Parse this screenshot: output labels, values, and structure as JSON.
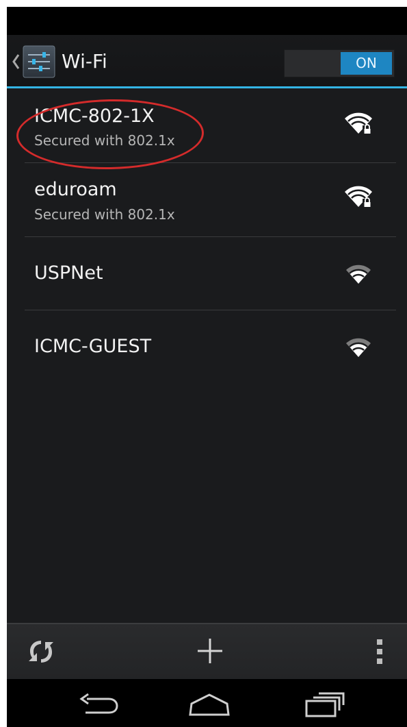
{
  "action_bar": {
    "title": "Wi-Fi",
    "toggle_label": "ON",
    "accent_color": "#33b5e5"
  },
  "networks": [
    {
      "name": "ICMC-802-1X",
      "security": "Secured with 802.1x",
      "icon": "wifi-signal-locked-icon"
    },
    {
      "name": "eduroam",
      "security": "Secured with 802.1x",
      "icon": "wifi-signal-locked-icon"
    },
    {
      "name": "USPNet",
      "security": "",
      "icon": "wifi-signal-icon"
    },
    {
      "name": "ICMC-GUEST",
      "security": "",
      "icon": "wifi-signal-icon"
    }
  ],
  "annotation_color": "#d42b2b",
  "bottom_bar": {
    "icons": [
      "wps-refresh-icon",
      "add-icon",
      "overflow-menu-icon"
    ]
  },
  "nav_bar": {
    "icons": [
      "back-icon",
      "home-icon",
      "recent-apps-icon"
    ]
  }
}
